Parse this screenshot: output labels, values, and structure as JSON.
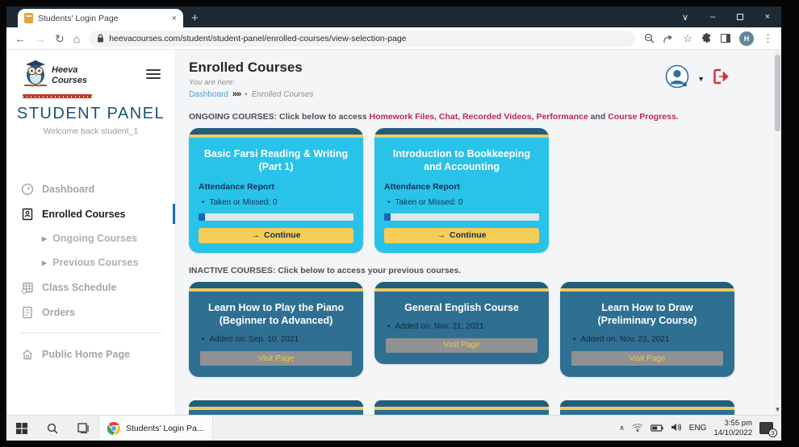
{
  "window": {
    "tab_title": "Students' Login Page",
    "url": "heevacourses.com/student/student-panel/enrolled-courses/view-selection-page",
    "profile_initial": "H"
  },
  "glyphs": {
    "tab_close": "×",
    "new_tab": "+",
    "window_chevron": "∨",
    "minimize": "–",
    "close": "×",
    "back": "←",
    "forward": "→",
    "reload": "↻",
    "home": "⌂",
    "star": "☆",
    "menu_dots": "⋮",
    "sub_arrow": "▶",
    "breadcrumb_chevrons": "»»",
    "dot": "•",
    "bullet": "•",
    "continue_arrow": "→",
    "caret_down": "▼",
    "tray_chevron": "∧",
    "scroll_arrow": "▼"
  },
  "sidebar": {
    "brand_name_line1": "Heeva",
    "brand_name_line2": "Courses",
    "panel_title": "STUDENT PANEL",
    "welcome": "Welcome back student_1",
    "menu": [
      {
        "label": "Dashboard"
      },
      {
        "label": "Enrolled Courses"
      },
      {
        "label": "Ongoing Courses"
      },
      {
        "label": "Previous Courses"
      },
      {
        "label": "Class Schedule"
      },
      {
        "label": "Orders"
      },
      {
        "label": "Public Home Page"
      }
    ]
  },
  "main": {
    "page_title": "Enrolled Courses",
    "you_are_here": "You are here:",
    "breadcrumb": {
      "link": "Dashboard",
      "current": "Enrolled Courses"
    },
    "ongoing": {
      "prefix": "ONGOING COURSES: Click below to access",
      "highlights": [
        "Homework Files,",
        "Chat,",
        "Recorded Videos,",
        "Performance",
        "Course Progress."
      ],
      "conjunction": "and",
      "cards": [
        {
          "title": "Basic Farsi Reading & Writing (Part 1)",
          "report_label": "Attendance Report",
          "stat": "Taken or Missed: 0",
          "progress_percent": 4,
          "button_label": "Continue"
        },
        {
          "title": "Introduction to Bookkeeping and Accounting",
          "report_label": "Attendance Report",
          "stat": "Taken or Missed: 0",
          "progress_percent": 4,
          "button_label": "Continue"
        }
      ]
    },
    "inactive": {
      "heading": "INACTIVE COURSES: Click below to access your previous courses.",
      "cards": [
        {
          "title": "Learn How to Play the Piano (Beginner to Advanced)",
          "added": "Added on: Sep. 10, 2021",
          "button_label": "Visit Page"
        },
        {
          "title": "General English Course",
          "added": "Added on: Nov. 21, 2021",
          "button_label": "Visit Page"
        },
        {
          "title": "Learn How to Draw (Preliminary Course)",
          "added": "Added on: Nov. 23, 2021",
          "button_label": "Visit Page"
        }
      ]
    }
  },
  "taskbar": {
    "app_label": "Students' Login Pa...",
    "language": "ENG",
    "time": "3:55 pm",
    "date": "14/10/2022",
    "notification_count": "3"
  },
  "colors": {
    "ongoing_card": "#29c2e8",
    "inactive_card": "#2e6f92",
    "card_top_navy": "#235d7c",
    "accent_yellow": "#f2c95e",
    "highlight_red": "#c3264a",
    "link_blue": "#3ea6cd",
    "panel_navy": "#1d5273",
    "progress_blue": "#1565c0"
  }
}
